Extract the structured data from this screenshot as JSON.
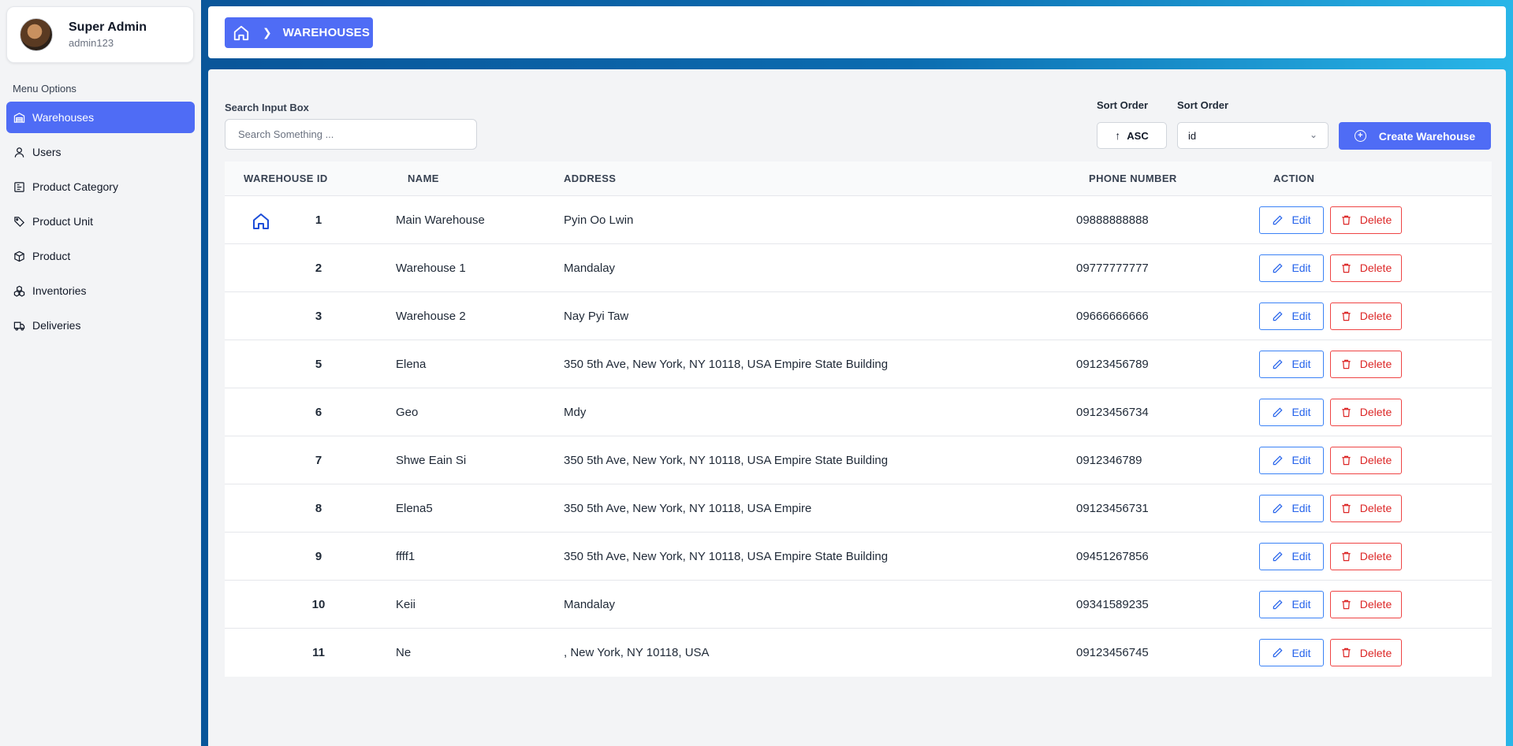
{
  "sidebar": {
    "profile": {
      "name": "Super Admin",
      "username": "admin123"
    },
    "menu_heading": "Menu Options",
    "items": [
      {
        "label": "Warehouses",
        "icon": "warehouse-icon",
        "active": true
      },
      {
        "label": "Users",
        "icon": "user-icon",
        "active": false
      },
      {
        "label": "Product Category",
        "icon": "category-icon",
        "active": false
      },
      {
        "label": "Product Unit",
        "icon": "tag-icon",
        "active": false
      },
      {
        "label": "Product",
        "icon": "box-icon",
        "active": false
      },
      {
        "label": "Inventories",
        "icon": "boxes-icon",
        "active": false
      },
      {
        "label": "Deliveries",
        "icon": "truck-icon",
        "active": false
      }
    ]
  },
  "breadcrumb": {
    "home_icon": "home-icon",
    "current": "WAREHOUSES"
  },
  "toolbar": {
    "search_label": "Search Input Box",
    "search_placeholder": "Search Something ...",
    "sort_order_label": "Sort Order",
    "sort_field_label": "Sort Order",
    "sort_direction": "ASC",
    "sort_field": "id",
    "create_label": "Create Warehouse"
  },
  "table": {
    "headers": {
      "id": "WAREHOUSE ID",
      "name": "NAME",
      "address": "ADDRESS",
      "phone": "PHONE NUMBER",
      "action": "ACTION"
    },
    "edit_label": "Edit",
    "delete_label": "Delete",
    "rows": [
      {
        "id": "1",
        "name": "Main Warehouse",
        "address": "Pyin Oo Lwin",
        "phone": "09888888888",
        "main": true
      },
      {
        "id": "2",
        "name": "Warehouse 1",
        "address": "Mandalay",
        "phone": "09777777777",
        "main": false
      },
      {
        "id": "3",
        "name": "Warehouse 2",
        "address": "Nay Pyi Taw",
        "phone": "09666666666",
        "main": false
      },
      {
        "id": "5",
        "name": "Elena",
        "address": "350 5th Ave, New York, NY 10118, USA Empire State Building",
        "phone": "09123456789",
        "main": false
      },
      {
        "id": "6",
        "name": "Geo",
        "address": "Mdy",
        "phone": "09123456734",
        "main": false
      },
      {
        "id": "7",
        "name": "Shwe Eain Si",
        "address": "350 5th Ave, New York, NY 10118, USA Empire State Building",
        "phone": "0912346789",
        "main": false
      },
      {
        "id": "8",
        "name": "Elena5",
        "address": "350 5th Ave, New York, NY 10118, USA Empire",
        "phone": "09123456731",
        "main": false
      },
      {
        "id": "9",
        "name": "ffff1",
        "address": "350 5th Ave, New York, NY 10118, USA Empire State Building",
        "phone": "09451267856",
        "main": false
      },
      {
        "id": "10",
        "name": "Keii",
        "address": "Mandalay",
        "phone": "09341589235",
        "main": false
      },
      {
        "id": "11",
        "name": "Ne",
        "address": ", New York, NY 10118, USA",
        "phone": "09123456745",
        "main": false
      }
    ]
  },
  "colors": {
    "accent": "#4f6cf5",
    "edit": "#2563eb",
    "delete": "#dc2626",
    "background_gradient_start": "#0a4f93",
    "background_gradient_end": "#29b6e8"
  }
}
